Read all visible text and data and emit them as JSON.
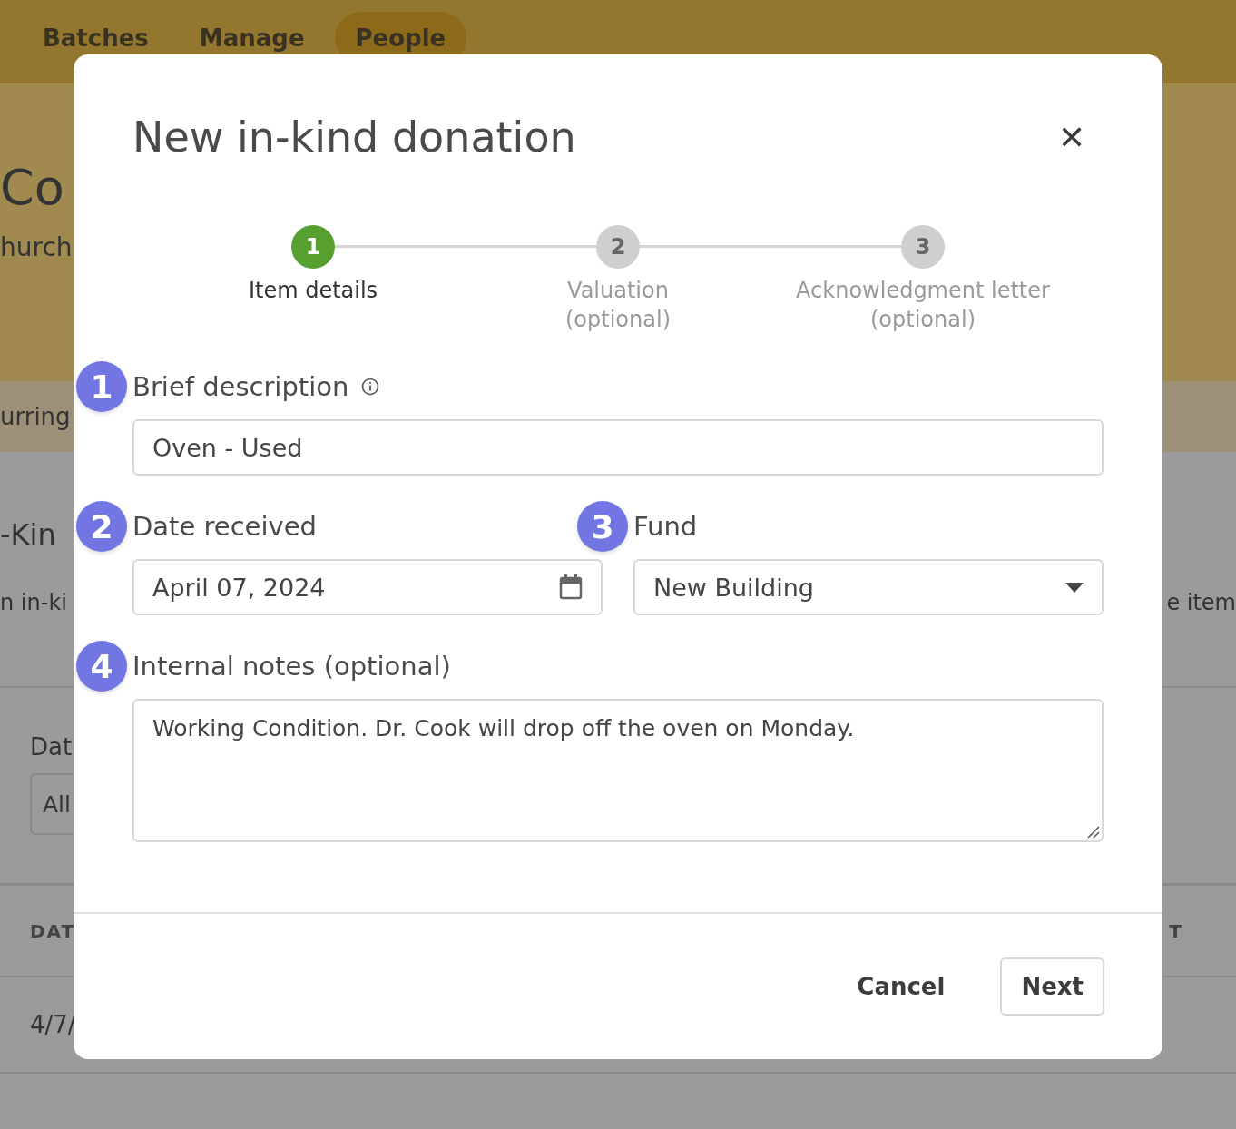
{
  "background": {
    "nav_tabs": [
      {
        "label": "Batches",
        "selected": false
      },
      {
        "label": "Manage",
        "selected": false
      },
      {
        "label": "People",
        "selected": true
      }
    ],
    "heading": "Co",
    "subheading": "hurch",
    "tab": "urring",
    "section_title": "-Kin",
    "section_text_left": "n in-ki",
    "section_text_right": "e item",
    "filter_label": "Dat",
    "filter_value": "All",
    "table_header_left": "DAT",
    "table_header_right": "T",
    "table_cell": "4/7/"
  },
  "dialog": {
    "title": "New in-kind donation",
    "close": "✕",
    "steps": [
      {
        "number": "1",
        "label": "Item details",
        "selected": true
      },
      {
        "number": "2",
        "label": "Valuation",
        "note": "(optional)",
        "selected": false
      },
      {
        "number": "3",
        "label": "Acknowledgment letter",
        "note": "(optional)",
        "selected": false
      }
    ],
    "fields": [
      {
        "kind": "text",
        "badge": "1",
        "label": "Brief description",
        "info": true,
        "value": "Oven - Used"
      },
      {
        "kind": "date",
        "badge": "2",
        "label": "Date received",
        "value": "April 07, 2024"
      },
      {
        "kind": "select",
        "badge": "3",
        "label": "Fund",
        "value": "New Building"
      },
      {
        "kind": "textarea",
        "badge": "4",
        "label": "Internal notes (optional)",
        "value": "Working Condition. Dr. Cook will drop off the oven on Monday."
      }
    ],
    "buttons": [
      {
        "kind": "text",
        "label": "Cancel"
      },
      {
        "kind": "outlined",
        "label": "Next"
      }
    ]
  }
}
